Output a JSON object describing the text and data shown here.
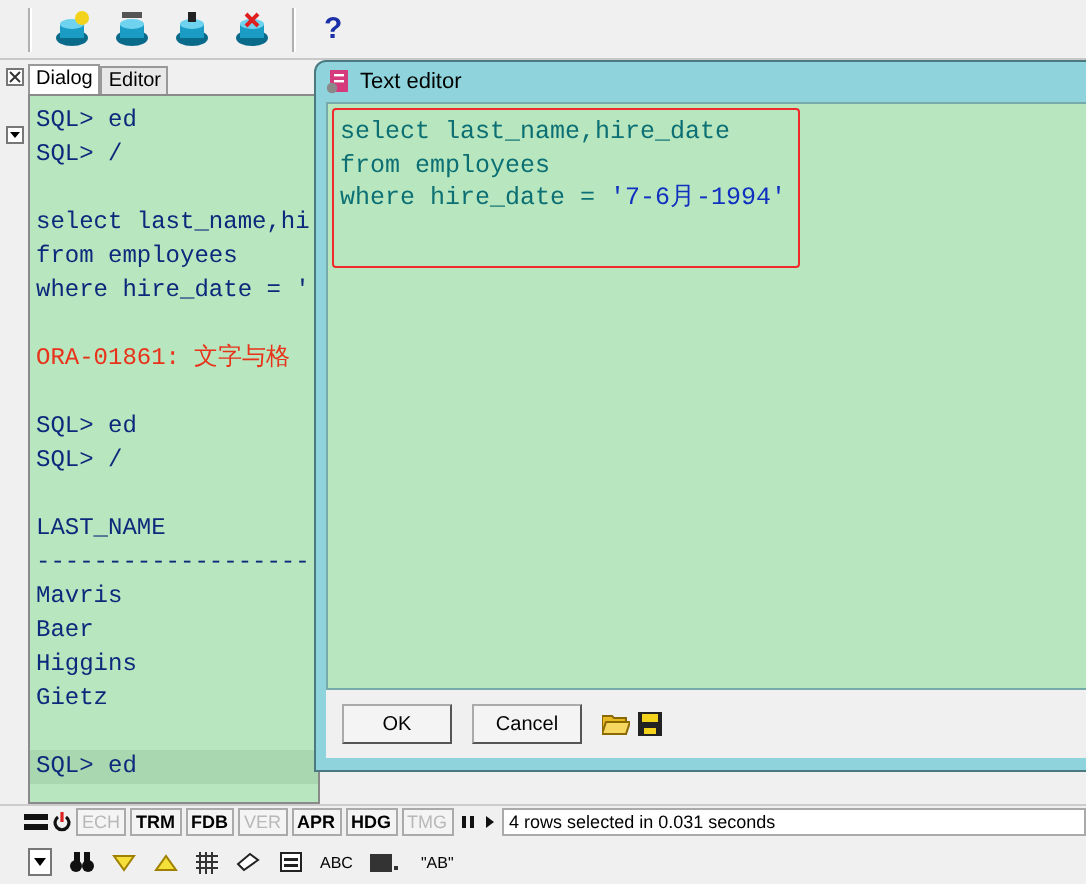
{
  "toolbar": {
    "help": "?"
  },
  "tabs": [
    {
      "label": "Dialog",
      "selected": true
    },
    {
      "label": "Editor",
      "selected": false
    }
  ],
  "console": {
    "lines": [
      {
        "kind": "prompt",
        "text": "SQL> ed"
      },
      {
        "kind": "prompt",
        "text": "SQL> /"
      },
      {
        "kind": "blank"
      },
      {
        "kind": "sql",
        "text": "select last_name,hi"
      },
      {
        "kind": "sql",
        "text": "from employees"
      },
      {
        "kind": "sql",
        "text": "where hire_date = '"
      },
      {
        "kind": "blank"
      },
      {
        "kind": "error",
        "text": "ORA-01861: 文字与格"
      },
      {
        "kind": "blank"
      },
      {
        "kind": "prompt",
        "text": "SQL> ed"
      },
      {
        "kind": "prompt",
        "text": "SQL> /"
      },
      {
        "kind": "blank"
      },
      {
        "kind": "output",
        "text": "LAST_NAME"
      },
      {
        "kind": "output",
        "text": "-------------------"
      },
      {
        "kind": "output",
        "text": "Mavris"
      },
      {
        "kind": "output",
        "text": "Baer"
      },
      {
        "kind": "output",
        "text": "Higgins"
      },
      {
        "kind": "output",
        "text": "Gietz"
      },
      {
        "kind": "blank"
      },
      {
        "kind": "current",
        "text": "SQL> ed"
      }
    ]
  },
  "dialog": {
    "title": "Text editor",
    "lines": [
      {
        "text": "select last_name,hire_date"
      },
      {
        "text": "from employees"
      },
      {
        "text": "where hire_date = ",
        "literal": "'7-6月-1994'"
      }
    ],
    "buttons": [
      "OK",
      "Cancel"
    ]
  },
  "status_bar": {
    "flags": [
      {
        "label": "ECH",
        "disabled": true
      },
      {
        "label": "TRM",
        "disabled": false
      },
      {
        "label": "FDB",
        "disabled": false
      },
      {
        "label": "VER",
        "disabled": true
      },
      {
        "label": "APR",
        "disabled": false
      },
      {
        "label": "HDG",
        "disabled": false
      },
      {
        "label": "TMG",
        "disabled": true
      }
    ],
    "message": "4 rows selected in 0.031 seconds"
  },
  "bottom_toolbar": {
    "abc": "ABC",
    "ab": "\"AB\""
  }
}
